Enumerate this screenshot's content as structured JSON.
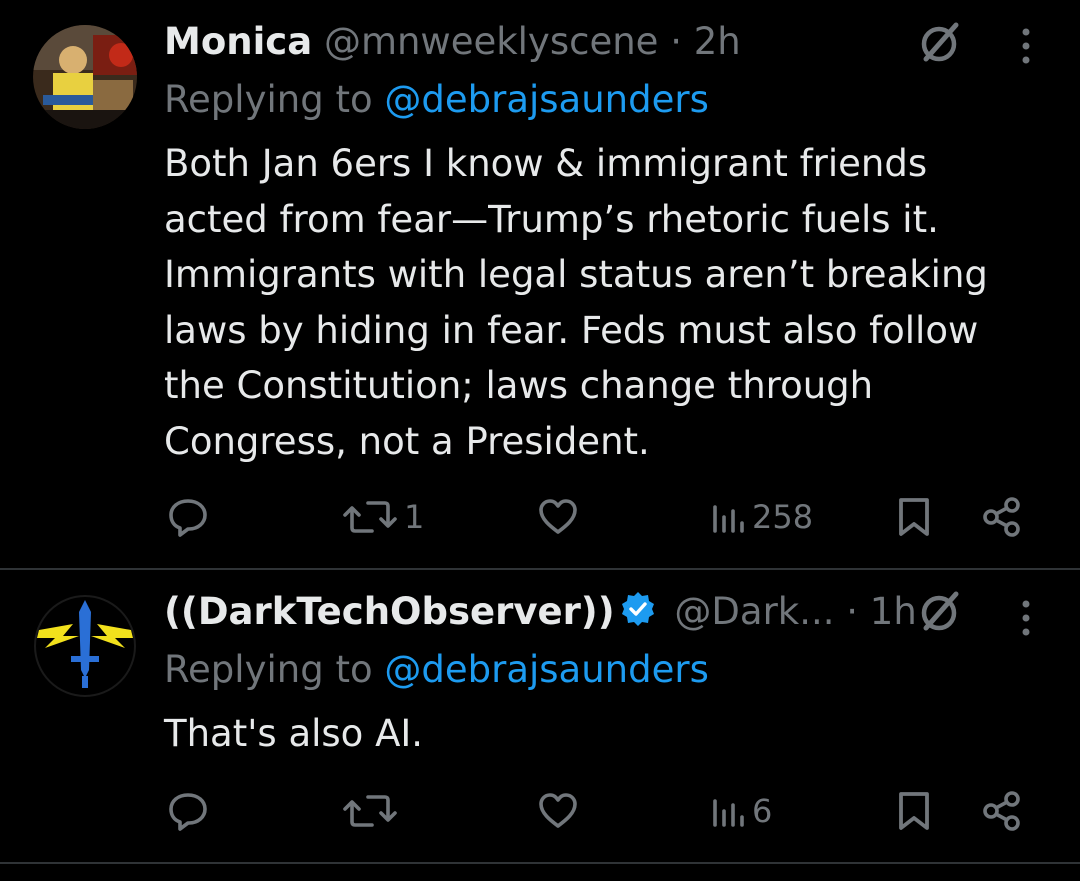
{
  "posts": [
    {
      "display_name": "Monica",
      "handle": "@mnweeklyscene",
      "separator": "·",
      "time": "2h",
      "replying_prefix": "Replying to",
      "replying_to": "@debrajsaunders",
      "text": "Both Jan 6ers I know & immigrant friends acted from fear—Trump’s rhetoric fuels it. Immigrants with legal status aren’t breaking laws by hiding in fear. Feds must also follow the Constitution; laws change through Congress, not a President.",
      "verified": false,
      "actions": {
        "reply_count": "",
        "repost_count": "1",
        "like_count": "",
        "views_count": "258"
      }
    },
    {
      "display_name": "((DarkTechObserver))",
      "handle": "@Dark...",
      "separator": "·",
      "time": "1h",
      "replying_prefix": "Replying to",
      "replying_to": "@debrajsaunders",
      "text": "That's also AI.",
      "verified": true,
      "actions": {
        "reply_count": "",
        "repost_count": "",
        "like_count": "",
        "views_count": "6"
      }
    }
  ],
  "icons": {
    "reply": "reply-icon",
    "repost": "repost-icon",
    "like": "heart-icon",
    "views": "views-icon",
    "bookmark": "bookmark-icon",
    "share": "share-icon",
    "grok": "grok-icon",
    "more": "more-vertical-icon",
    "verified": "verified-badge-icon"
  },
  "colors": {
    "background": "#000000",
    "text_primary": "#e7e9ea",
    "text_secondary": "#71767b",
    "link": "#1d9bf0",
    "divider": "#2f3336"
  }
}
